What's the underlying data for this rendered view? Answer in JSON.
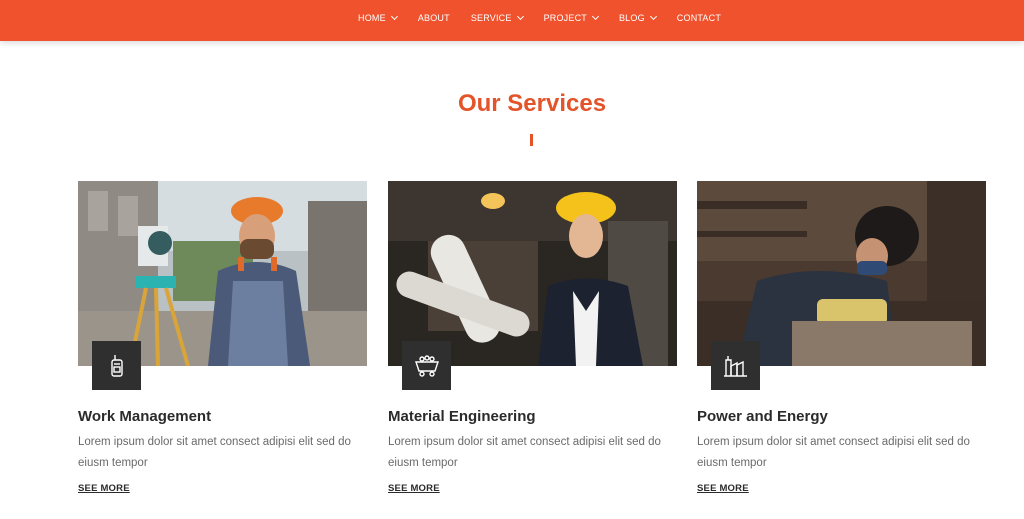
{
  "nav": {
    "items": [
      {
        "label": "HOME",
        "dropdown": true
      },
      {
        "label": "ABOUT",
        "dropdown": false
      },
      {
        "label": "SERVICE",
        "dropdown": true
      },
      {
        "label": "PROJECT",
        "dropdown": true
      },
      {
        "label": "BLOG",
        "dropdown": true
      },
      {
        "label": "CONTACT",
        "dropdown": false
      }
    ]
  },
  "section": {
    "title": "Our Services"
  },
  "colors": {
    "accent": "#f0522d",
    "heading": "#e4542a",
    "badge": "#2f2f2f"
  },
  "cards": [
    {
      "icon": "walkie-talkie-icon",
      "title": "Work Management",
      "text": "Lorem ipsum dolor sit amet consect adipisi elit sed do eiusm tempor",
      "link": "SEE MORE"
    },
    {
      "icon": "mine-cart-icon",
      "title": "Material Engineering",
      "text": "Lorem ipsum dolor sit amet consect adipisi elit sed do eiusm tempor",
      "link": "SEE MORE"
    },
    {
      "icon": "factory-icon",
      "title": "Power and Energy",
      "text": "Lorem ipsum dolor sit amet consect adipisi elit sed do eiusm tempor",
      "link": "SEE MORE"
    }
  ]
}
